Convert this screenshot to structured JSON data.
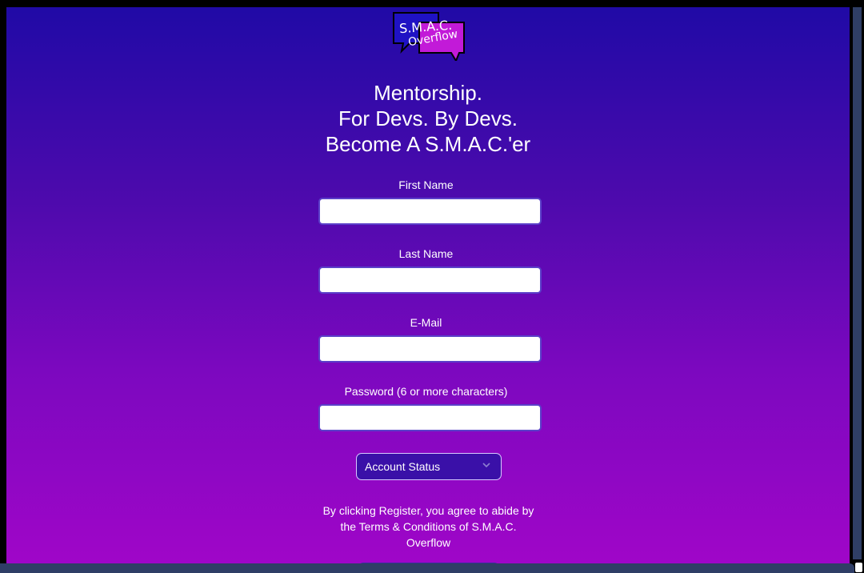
{
  "logo": {
    "line1": "S.M.A.C.",
    "line2": "Overflow",
    "colors": {
      "bubble_left": "#1f12c4",
      "bubble_right": "#c21ad8"
    }
  },
  "headline": {
    "line1": "Mentorship.",
    "line2": "For Devs. By Devs.",
    "line3": "Become A S.M.A.C.'er"
  },
  "form": {
    "first_name_label": "First Name",
    "first_name_value": "",
    "last_name_label": "Last Name",
    "last_name_value": "",
    "email_label": "E-Mail",
    "email_value": "",
    "password_label": "Password (6 or more characters)",
    "password_value": "",
    "account_status": {
      "selected": "Account Status",
      "icon": "chevron-down-icon"
    },
    "terms_text": "By clicking Register, you agree to abide by the Terms & Conditions of S.M.A.C. Overflow"
  },
  "colors": {
    "gradient_top": "#200aa6",
    "gradient_bottom": "#a006c8",
    "scrollbar": "#2f3e66"
  }
}
